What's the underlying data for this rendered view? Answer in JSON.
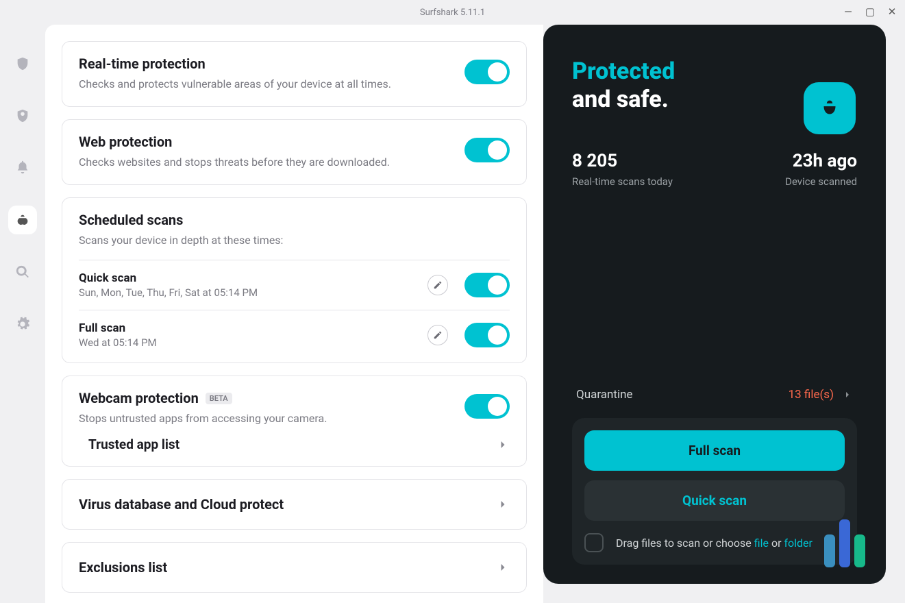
{
  "window": {
    "title": "Surfshark 5.11.1"
  },
  "settings": {
    "realtime": {
      "title": "Real-time protection",
      "desc": "Checks and protects vulnerable areas of your device at all times."
    },
    "web": {
      "title": "Web protection",
      "desc": "Checks websites and stops threats before they are downloaded."
    },
    "scheduled": {
      "title": "Scheduled scans",
      "desc": "Scans your device in depth at these times:",
      "quick": {
        "name": "Quick scan",
        "time": "Sun, Mon, Tue, Thu, Fri, Sat at 05:14 PM"
      },
      "full": {
        "name": "Full scan",
        "time": "Wed at 05:14 PM"
      }
    },
    "webcam": {
      "title": "Webcam protection",
      "badge": "BETA",
      "desc": "Stops untrusted apps from accessing your camera.",
      "trusted_link": "Trusted app list"
    },
    "virus_db": {
      "title": "Virus database and Cloud protect"
    },
    "exclusions": {
      "title": "Exclusions list"
    }
  },
  "panel": {
    "status_line1": "Protected",
    "status_line2": "and safe.",
    "scans_today_value": "8 205",
    "scans_today_label": "Real-time scans today",
    "scanned_value": "23h ago",
    "scanned_label": "Device scanned",
    "quarantine_label": "Quarantine",
    "quarantine_count": "13 file(s)",
    "full_scan_btn": "Full scan",
    "quick_scan_btn": "Quick scan",
    "drop_text_prefix": "Drag files to scan or choose ",
    "drop_link_file": "file",
    "drop_text_or": " or ",
    "drop_link_folder": "folder"
  }
}
